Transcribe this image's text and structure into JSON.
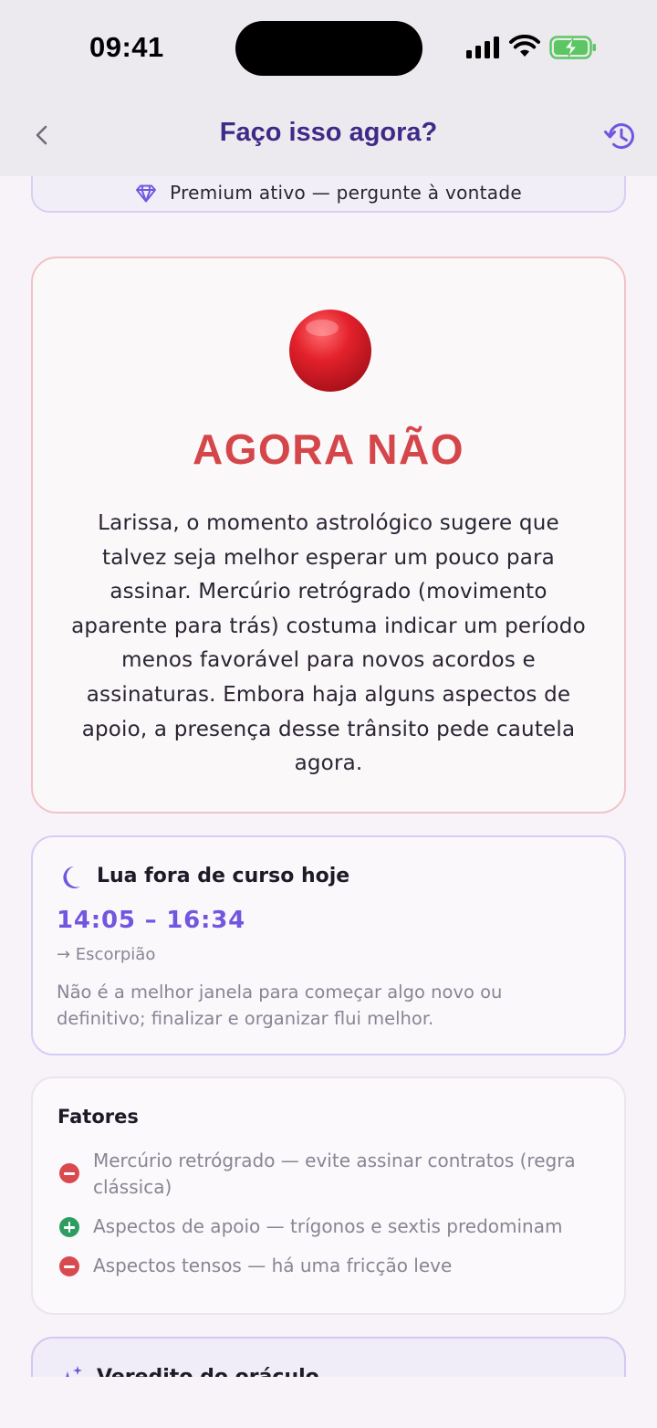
{
  "status_bar": {
    "time": "09:41"
  },
  "nav": {
    "title": "Faço isso agora?"
  },
  "premium": {
    "text": "Premium ativo — pergunte à vontade"
  },
  "verdict": {
    "title": "AGORA NÃO",
    "text": "Larissa, o momento astrológico sugere que talvez seja melhor esperar um pouco para assinar. Mercúrio retrógrado (movimento aparente para trás) costuma indicar um período menos favorável para novos acordos e assinaturas. Embora haja alguns aspectos de apoio, a presença desse trânsito pede cautela agora."
  },
  "moon": {
    "title": "Lua fora de curso hoje",
    "time_range": "14:05 – 16:34",
    "sign": "→ Escorpião",
    "note": "Não é a melhor janela para começar algo novo ou definitivo; finalizar e organizar flui melhor."
  },
  "factors": {
    "title": "Fatores",
    "items": [
      {
        "type": "negative",
        "text": "Mercúrio retrógrado — evite assinar contratos (regra clássica)"
      },
      {
        "type": "positive",
        "text": "Aspectos de apoio — trígonos e sextis predominam"
      },
      {
        "type": "negative",
        "text": "Aspectos tensos — há uma fricção leve"
      }
    ]
  },
  "oracle": {
    "title": "Veredito do oráculo"
  },
  "colors": {
    "accent": "#7157DF",
    "verdict_red": "#D5464B",
    "negative": "#D94A4F",
    "positive": "#2E9D62"
  },
  "icons": {
    "back": "chevron-left-icon",
    "history": "history-icon",
    "premium": "diamond-icon",
    "verdict": "red-circle-icon",
    "moon": "crescent-moon-icon",
    "oracle": "sparkles-icon"
  }
}
